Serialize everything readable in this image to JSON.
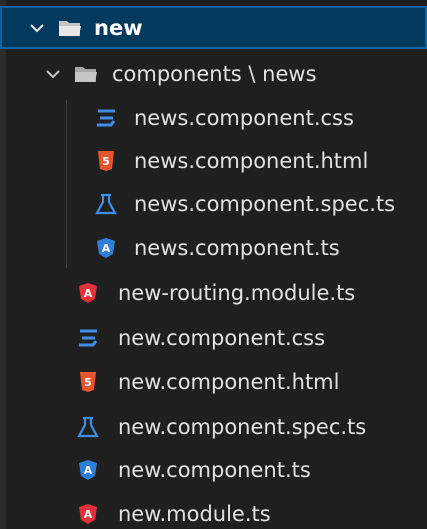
{
  "explorer": {
    "folders": {
      "new": {
        "label": "new",
        "expanded": true,
        "icon": "folder-open-icon"
      },
      "components_news": {
        "label": "components \\ news",
        "expanded": true,
        "icon": "folder-open-icon"
      }
    },
    "files": [
      {
        "label": "news.component.css",
        "icon": "css-file-icon",
        "color": "#3d8ee6"
      },
      {
        "label": "news.component.html",
        "icon": "html-file-icon",
        "color": "#e4572e"
      },
      {
        "label": "news.component.spec.ts",
        "icon": "test-flask-icon",
        "color": "#3d8ee6"
      },
      {
        "label": "news.component.ts",
        "icon": "angular-component-icon",
        "color": "#2f7fd6"
      },
      {
        "label": "new-routing.module.ts",
        "icon": "angular-module-icon",
        "color": "#e23237"
      },
      {
        "label": "new.component.css",
        "icon": "css-file-icon",
        "color": "#3d8ee6"
      },
      {
        "label": "new.component.html",
        "icon": "html-file-icon",
        "color": "#e4572e"
      },
      {
        "label": "new.component.spec.ts",
        "icon": "test-flask-icon",
        "color": "#3d8ee6"
      },
      {
        "label": "new.component.ts",
        "icon": "angular-component-icon",
        "color": "#2f7fd6"
      },
      {
        "label": "new.module.ts",
        "icon": "angular-module-icon",
        "color": "#e23237"
      }
    ]
  },
  "colors": {
    "background": "#1f1f1f",
    "selection": "#04395e",
    "selection_border": "#0e639c",
    "folder": "#c5c5c5"
  }
}
